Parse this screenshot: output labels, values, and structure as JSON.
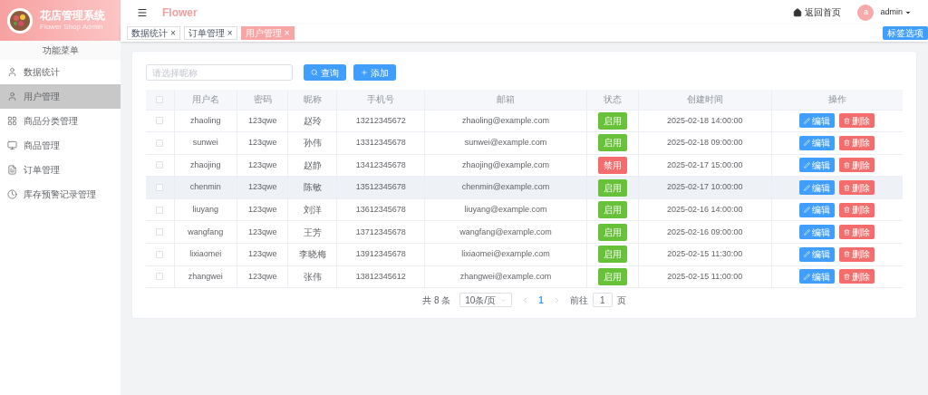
{
  "sidebar": {
    "title": "花店管理系统",
    "subtitle": "Flower Shop Admin",
    "menu_heading": "功能菜单",
    "items": [
      {
        "label": "数据统计",
        "selected": false
      },
      {
        "label": "用户管理",
        "selected": true
      },
      {
        "label": "商品分类管理",
        "selected": false
      },
      {
        "label": "商品管理",
        "selected": false
      },
      {
        "label": "订单管理",
        "selected": false
      },
      {
        "label": "库存预警记录管理",
        "selected": false
      }
    ]
  },
  "header": {
    "brand": "Flower",
    "home_link": "返回首页",
    "avatar_letter": "a",
    "user": "admin"
  },
  "tabs": [
    {
      "label": "数据统计",
      "close": "×",
      "selected": false
    },
    {
      "label": "订单管理",
      "close": "×",
      "selected": false
    },
    {
      "label": "用户管理",
      "close": "×",
      "selected": true
    }
  ],
  "tab_options": "标签选项",
  "toolbar": {
    "search_placeholder": "请选择昵称",
    "query": "查询",
    "add": "添加"
  },
  "table": {
    "header_checked": false,
    "columns": [
      "用户名",
      "密码",
      "昵称",
      "手机号",
      "邮箱",
      "状态",
      "创建时间",
      "操作"
    ],
    "rows": [
      {
        "checked": false,
        "hovered": false,
        "username": "zhaoling",
        "password": "123qwe",
        "nickname": "赵玲",
        "phone": "13212345672",
        "email": "zhaoling@example.com",
        "status": "启用",
        "enabled": true,
        "created": "2025-02-18 14:00:00",
        "edit": "编辑",
        "delete": "删除"
      },
      {
        "checked": false,
        "hovered": false,
        "username": "sunwei",
        "password": "123qwe",
        "nickname": "孙伟",
        "phone": "13312345678",
        "email": "sunwei@example.com",
        "status": "启用",
        "enabled": true,
        "created": "2025-02-18 09:00:00",
        "edit": "编辑",
        "delete": "删除"
      },
      {
        "checked": false,
        "hovered": false,
        "username": "zhaojing",
        "password": "123qwe",
        "nickname": "赵静",
        "phone": "13412345678",
        "email": "zhaojing@example.com",
        "status": "禁用",
        "enabled": false,
        "created": "2025-02-17 15:00:00",
        "edit": "编辑",
        "delete": "删除"
      },
      {
        "checked": false,
        "hovered": true,
        "username": "chenmin",
        "password": "123qwe",
        "nickname": "陈敏",
        "phone": "13512345678",
        "email": "chenmin@example.com",
        "status": "启用",
        "enabled": true,
        "created": "2025-02-17 10:00:00",
        "edit": "编辑",
        "delete": "删除"
      },
      {
        "checked": false,
        "hovered": false,
        "username": "liuyang",
        "password": "123qwe",
        "nickname": "刘洋",
        "phone": "13612345678",
        "email": "liuyang@example.com",
        "status": "启用",
        "enabled": true,
        "created": "2025-02-16 14:00:00",
        "edit": "编辑",
        "delete": "删除"
      },
      {
        "checked": false,
        "hovered": false,
        "username": "wangfang",
        "password": "123qwe",
        "nickname": "王芳",
        "phone": "13712345678",
        "email": "wangfang@example.com",
        "status": "启用",
        "enabled": true,
        "created": "2025-02-16 09:00:00",
        "edit": "编辑",
        "delete": "删除"
      },
      {
        "checked": false,
        "hovered": false,
        "username": "lixiaomei",
        "password": "123qwe",
        "nickname": "李晓梅",
        "phone": "13912345678",
        "email": "lixiaomei@example.com",
        "status": "启用",
        "enabled": true,
        "created": "2025-02-15 11:30:00",
        "edit": "编辑",
        "delete": "删除"
      },
      {
        "checked": false,
        "hovered": false,
        "username": "zhangwei",
        "password": "123qwe",
        "nickname": "张伟",
        "phone": "13812345612",
        "email": "zhangwei@example.com",
        "status": "启用",
        "enabled": true,
        "created": "2025-02-15 11:00:00",
        "edit": "编辑",
        "delete": "删除"
      }
    ]
  },
  "pagination": {
    "total": "共 8 条",
    "page_size": "10条/页",
    "pages": [
      {
        "label": "1",
        "selected": true
      }
    ],
    "goto_label": "前往",
    "goto_value": "1",
    "page_unit": "页"
  }
}
